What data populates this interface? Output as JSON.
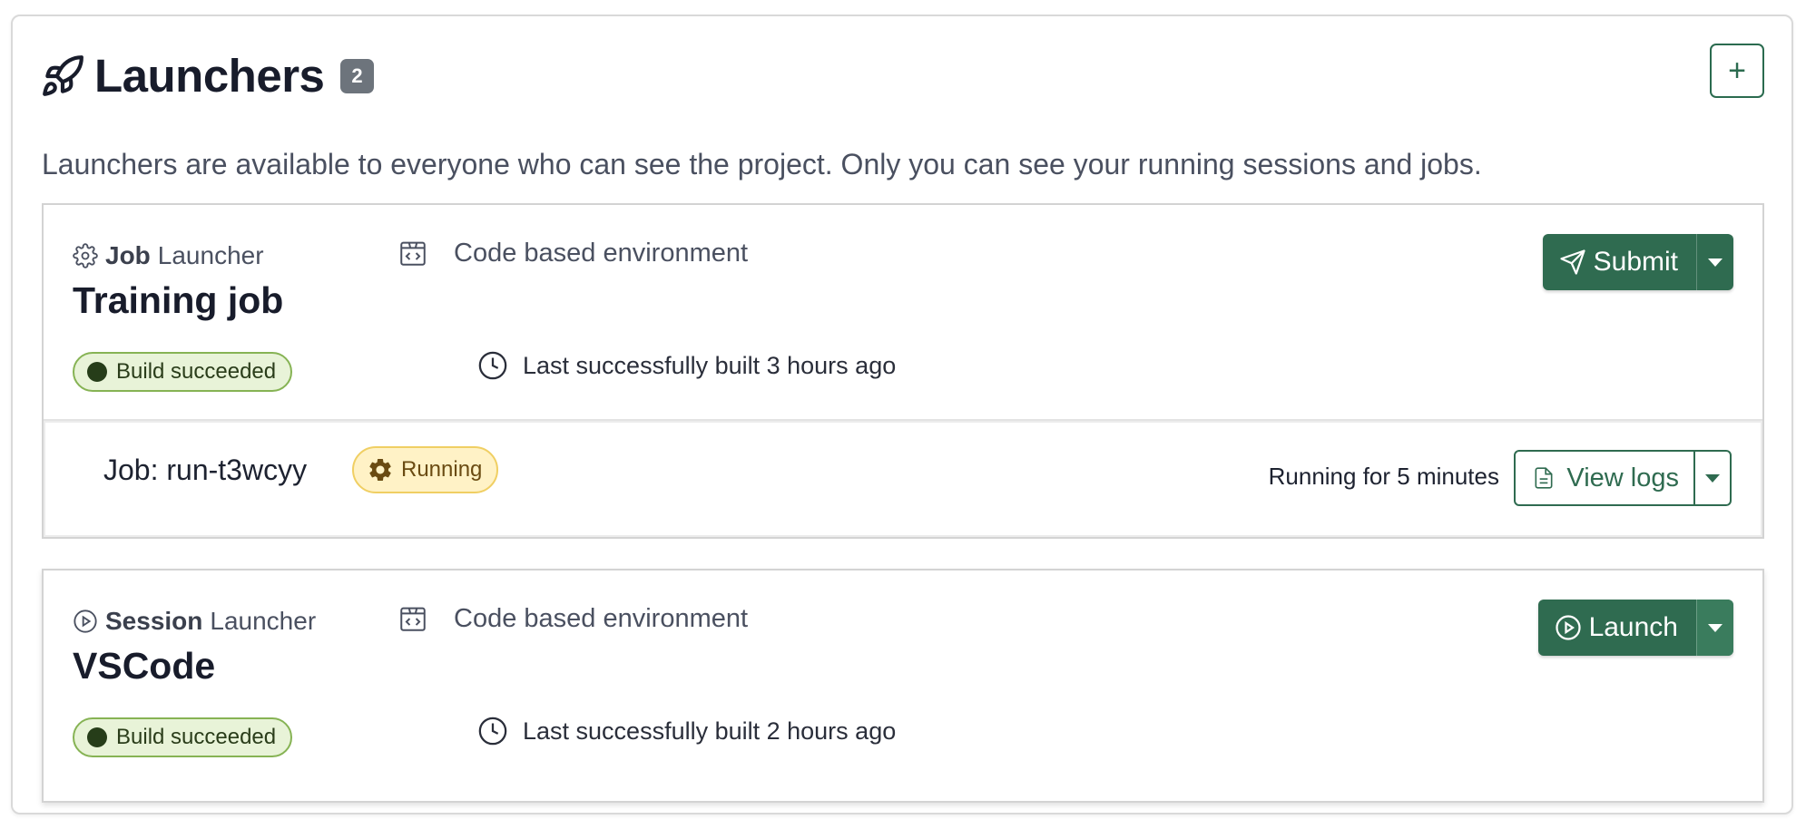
{
  "header": {
    "title": "Launchers",
    "count": "2",
    "add_label": "+",
    "description": "Launchers are available to everyone who can see the project. Only you can see your running sessions and jobs."
  },
  "launchers": [
    {
      "type_bold": "Job",
      "type_rest": "Launcher",
      "environment": "Code based environment",
      "title": "Training job",
      "build_status": "Build succeeded",
      "built_text": "Last successfully built 3 hours ago",
      "action_label": "Submit",
      "run": {
        "name": "Job: run-t3wcyy",
        "status": "Running",
        "duration": "Running for 5 minutes",
        "action_label": "View logs"
      }
    },
    {
      "type_bold": "Session",
      "type_rest": "Launcher",
      "environment": "Code based environment",
      "title": "VSCode",
      "build_status": "Build succeeded",
      "built_text": "Last successfully built 2 hours ago",
      "action_label": "Launch"
    }
  ],
  "colors": {
    "primary": "#2f6b50",
    "success_bg": "#e8f3d8",
    "warning_bg": "#fff2c6",
    "badge_gray": "#6d747c"
  },
  "icons": [
    "rocket-icon",
    "plus-icon",
    "gear-icon",
    "code-environment-icon",
    "clock-icon",
    "send-icon",
    "play-circle-icon",
    "file-text-icon",
    "chevron-down-icon"
  ]
}
